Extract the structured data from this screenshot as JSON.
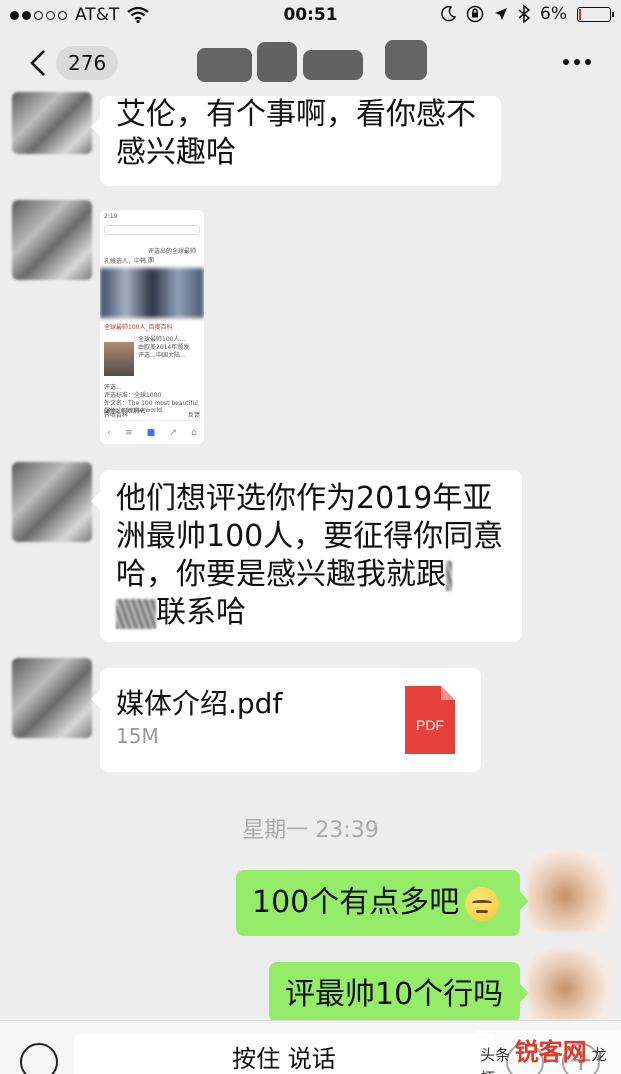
{
  "status_bar": {
    "carrier": "AT&T",
    "time": "00:51",
    "battery": "6%",
    "battery_fraction": 0.06,
    "icons": [
      "signal-dots-icon",
      "wifi-icon",
      "moon-icon",
      "orientation-lock-icon",
      "location-icon",
      "bluetooth-icon",
      "battery-icon"
    ]
  },
  "nav": {
    "unread_count": "276",
    "icons": [
      "back-chevron-icon",
      "more-dots-icon"
    ]
  },
  "messages": {
    "m1": {
      "line1": "艾伦，有个事啊，看你感不",
      "line2": "感兴趣哈"
    },
    "m3": {
      "line1": "他们想评选你作为2019年亚",
      "line2": "洲最帅100人，要征得你同意",
      "line3": "哈，你要是感兴趣我就跟",
      "line4": "联系哈"
    },
    "file": {
      "name": "媒体介绍.pdf",
      "size": "15M",
      "icon_label": "PDF"
    },
    "timestamp": "星期一 23:39",
    "m5": {
      "text": "100个有点多吧"
    },
    "m6": {
      "text": "评最帅10个行吗"
    }
  },
  "screenshot_thumb": {
    "time": "2:19",
    "line1": "评选出的全球最帅面",
    "line2": "孔候选人，中韩...",
    "heading": "全球最帅100人_百度百科",
    "body1": "全球最帅100人…",
    "body2": "由欧美2014年颁发",
    "body3": "评选…中国大陆…",
    "note1": "评选…",
    "note2": "评选标准：全球1000",
    "note3": "外文名：The 100 most beautiful people in the world",
    "note4": "属性：网络排名",
    "footer_left": "开收百科",
    "footer_right": "反馈"
  },
  "input": {
    "hold_to_talk": "按住 说话",
    "icons": [
      "keyboard-icon",
      "emoji-icon",
      "plus-icon"
    ]
  },
  "watermark": {
    "prefix": "头条",
    "brand": "锐客网",
    "suffix": "龙虾"
  },
  "colors": {
    "background": "#ededed",
    "bubble_in": "#ffffff",
    "bubble_out": "#95ec69",
    "pdf_red": "#e5403a",
    "timestamp": "#aaaaaa"
  }
}
